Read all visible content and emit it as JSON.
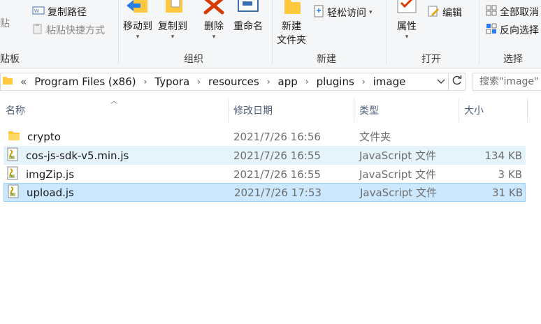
{
  "ribbon": {
    "clipboard": {
      "label": "剪贴板",
      "paste": "粘贴",
      "copy_path": "复制路径",
      "paste_shortcut": "粘贴快捷方式"
    },
    "organize": {
      "label": "组织",
      "move_to": "移动到",
      "copy_to": "复制到",
      "delete": "删除",
      "rename": "重命名"
    },
    "new": {
      "label": "新建",
      "new_folder_line1": "新建",
      "new_folder_line2": "文件夹",
      "easy_access": "轻松访问"
    },
    "open": {
      "label": "打开",
      "properties": "属性",
      "edit": "编辑"
    },
    "select": {
      "label": "选择",
      "select_all": "全部取消",
      "invert": "反向选择"
    }
  },
  "address": {
    "overflow": "«",
    "crumbs": [
      "Program Files (x86)",
      "Typora",
      "resources",
      "app",
      "plugins",
      "image"
    ]
  },
  "search": {
    "placeholder": "搜索\"image\""
  },
  "columns": {
    "name": "名称",
    "date": "修改日期",
    "type": "类型",
    "size": "大小"
  },
  "files": [
    {
      "name": "crypto",
      "date": "2021/7/26 16:56",
      "type": "文件夹",
      "size": "",
      "icon": "folder-icon",
      "state": "normal"
    },
    {
      "name": "cos-js-sdk-v5.min.js",
      "date": "2021/7/26 16:55",
      "type": "JavaScript 文件",
      "size": "134 KB",
      "icon": "js-file-icon",
      "state": "hover"
    },
    {
      "name": "imgZip.js",
      "date": "2021/7/26 16:55",
      "type": "JavaScript 文件",
      "size": "3 KB",
      "icon": "js-file-icon",
      "state": "normal"
    },
    {
      "name": "upload.js",
      "date": "2021/7/26 17:53",
      "type": "JavaScript 文件",
      "size": "31 KB",
      "icon": "js-file-icon",
      "state": "selected"
    }
  ],
  "colors": {
    "hover": "#e5f3fb",
    "selected": "#cce8ff",
    "folder": "#ffc83d",
    "delete_red": "#d83b01"
  }
}
